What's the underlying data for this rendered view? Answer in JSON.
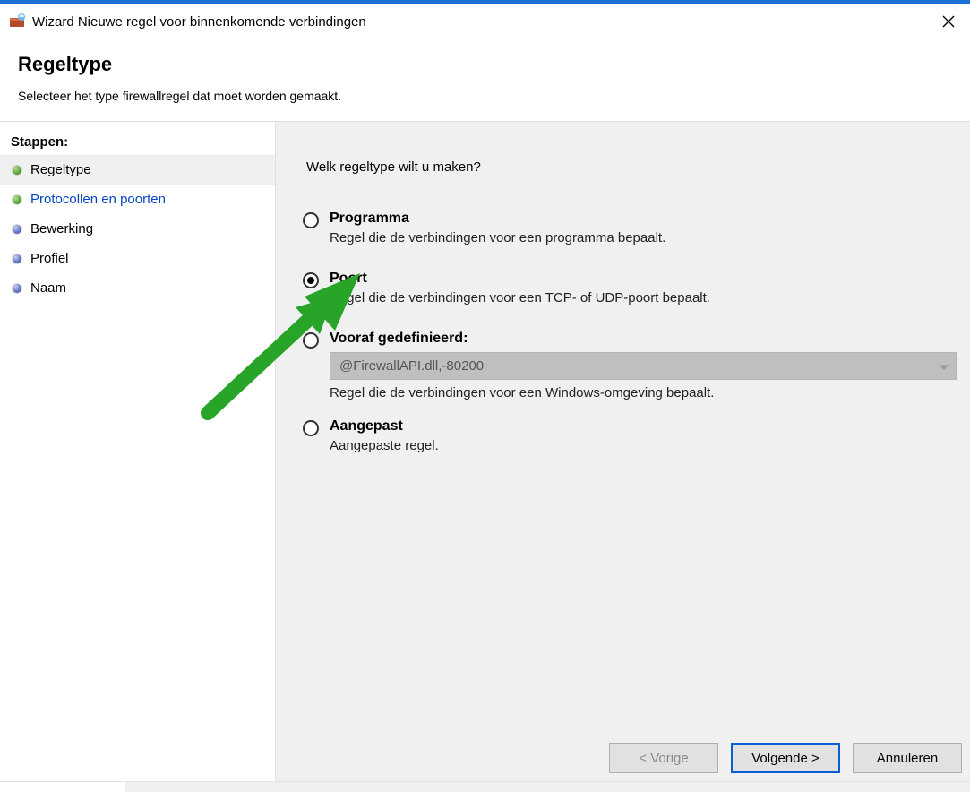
{
  "titlebar": {
    "title": "Wizard Nieuwe regel voor binnenkomende verbindingen"
  },
  "header": {
    "title": "Regeltype",
    "subtitle": "Selecteer het type firewallregel dat moet worden gemaakt."
  },
  "sidebar": {
    "title": "Stappen:",
    "items": [
      {
        "label": "Regeltype",
        "bullet": "green",
        "active": true,
        "link": false
      },
      {
        "label": "Protocollen en poorten",
        "bullet": "green",
        "active": false,
        "link": true
      },
      {
        "label": "Bewerking",
        "bullet": "blue",
        "active": false,
        "link": false
      },
      {
        "label": "Profiel",
        "bullet": "blue",
        "active": false,
        "link": false
      },
      {
        "label": "Naam",
        "bullet": "blue",
        "active": false,
        "link": false
      }
    ]
  },
  "main": {
    "question": "Welk regeltype wilt u maken?",
    "options": {
      "programma": {
        "title": "Programma",
        "desc": "Regel die de verbindingen voor een programma bepaalt.",
        "selected": false
      },
      "poort": {
        "title": "Poort",
        "desc": "Regel die de verbindingen voor een TCP- of UDP-poort bepaalt.",
        "selected": true
      },
      "vooraf": {
        "title": "Vooraf gedefinieerd:",
        "dropdown_value": "@FirewallAPI.dll,-80200",
        "desc": "Regel die de verbindingen voor een Windows-omgeving bepaalt.",
        "selected": false
      },
      "aangepast": {
        "title": "Aangepast",
        "desc": "Aangepaste regel.",
        "selected": false
      }
    }
  },
  "footer": {
    "back": "< Vorige",
    "next": "Volgende >",
    "cancel": "Annuleren"
  }
}
